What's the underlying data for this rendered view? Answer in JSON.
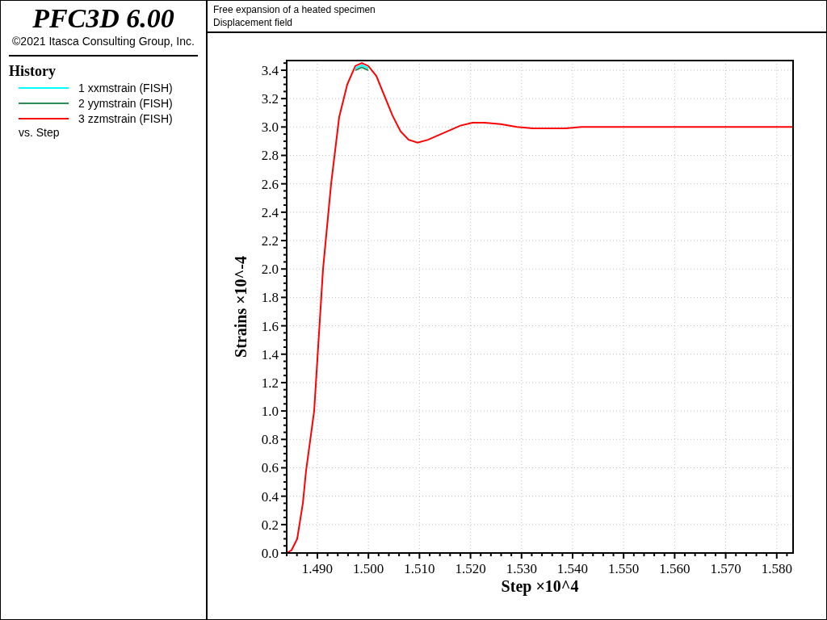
{
  "sidebar": {
    "title": "PFC3D 6.00",
    "copyright": "©2021 Itasca Consulting Group, Inc.",
    "legend_title": "History",
    "versus": "vs. Step"
  },
  "header": {
    "lines": [
      "Free expansion of a heated specimen",
      "Displacement field"
    ]
  },
  "plot": {
    "chart_data": {
      "type": "line",
      "grid": true,
      "xlabel": "Step ×10^4",
      "ylabel": "Strains ×10^-4",
      "x": [
        1.48399,
        1.48494,
        1.48604,
        1.48715,
        1.48778,
        1.48937,
        1.49111,
        1.49269,
        1.49427,
        1.49585,
        1.49744,
        1.4987,
        1.49997,
        1.50155,
        1.50313,
        1.50472,
        1.5063,
        1.50788,
        1.50962,
        1.51168,
        1.51484,
        1.51801,
        1.52038,
        1.52275,
        1.52592,
        1.52908,
        1.53225,
        1.53541,
        1.53858,
        1.54174,
        1.54491,
        1.55123,
        1.55598,
        1.56706,
        1.57813,
        1.5832
      ],
      "series": [
        {
          "name": "1 xxmstrain (FISH)",
          "color": "#00ffff",
          "values": [
            null,
            null,
            null,
            null,
            null,
            null,
            null,
            null,
            null,
            null,
            3.415,
            3.435,
            3.415,
            null,
            null,
            null,
            null,
            null,
            null,
            null,
            null,
            null,
            null,
            null,
            null,
            null,
            null,
            null,
            null,
            null,
            null,
            null,
            null,
            null,
            null,
            null
          ]
        },
        {
          "name": "2 yymstrain (FISH)",
          "color": "#2e8b57",
          "values": [
            null,
            null,
            null,
            null,
            null,
            null,
            null,
            null,
            null,
            null,
            3.4,
            3.42,
            3.4,
            null,
            null,
            null,
            null,
            null,
            null,
            null,
            null,
            null,
            null,
            null,
            null,
            null,
            null,
            null,
            null,
            null,
            null,
            null,
            null,
            null,
            null,
            null
          ]
        },
        {
          "name": "3 zzmstrain (FISH)",
          "color": "#ff0000",
          "values": [
            0.0,
            0.02,
            0.1,
            0.35,
            0.58,
            1.0,
            2.0,
            2.6,
            3.07,
            3.3,
            3.43,
            3.45,
            3.43,
            3.36,
            3.22,
            3.08,
            2.97,
            2.91,
            2.89,
            2.91,
            2.96,
            3.01,
            3.03,
            3.03,
            3.02,
            3.0,
            2.99,
            2.99,
            2.99,
            3.0,
            3.0,
            3.0,
            3.0,
            3.0,
            3.0,
            3.0
          ]
        }
      ],
      "xlim": [
        1.48399,
        1.5832
      ],
      "ylim": [
        0,
        3.468
      ],
      "xticks": [
        {
          "value": 1.49,
          "label": "1.490"
        },
        {
          "value": 1.5,
          "label": "1.500"
        },
        {
          "value": 1.51,
          "label": "1.510"
        },
        {
          "value": 1.52,
          "label": "1.520"
        },
        {
          "value": 1.53,
          "label": "1.530"
        },
        {
          "value": 1.54,
          "label": "1.540"
        },
        {
          "value": 1.55,
          "label": "1.550"
        },
        {
          "value": 1.56,
          "label": "1.560"
        },
        {
          "value": 1.57,
          "label": "1.570"
        },
        {
          "value": 1.58,
          "label": "1.580"
        }
      ],
      "yticks": [
        {
          "value": 0,
          "label": "0.0"
        },
        {
          "value": 0.2,
          "label": "0.2"
        },
        {
          "value": 0.4,
          "label": "0.4"
        },
        {
          "value": 0.6,
          "label": "0.6"
        },
        {
          "value": 0.8,
          "label": "0.8"
        },
        {
          "value": 1.0,
          "label": "1.0"
        },
        {
          "value": 1.2,
          "label": "1.2"
        },
        {
          "value": 1.4,
          "label": "1.4"
        },
        {
          "value": 1.6,
          "label": "1.6"
        },
        {
          "value": 1.8,
          "label": "1.8"
        },
        {
          "value": 2.0,
          "label": "2.0"
        },
        {
          "value": 2.2,
          "label": "2.2"
        },
        {
          "value": 2.4,
          "label": "2.4"
        },
        {
          "value": 2.6,
          "label": "2.6"
        },
        {
          "value": 2.8,
          "label": "2.8"
        },
        {
          "value": 3.0,
          "label": "3.0"
        },
        {
          "value": 3.2,
          "label": "3.2"
        },
        {
          "value": 3.4,
          "label": "3.4"
        }
      ]
    }
  }
}
